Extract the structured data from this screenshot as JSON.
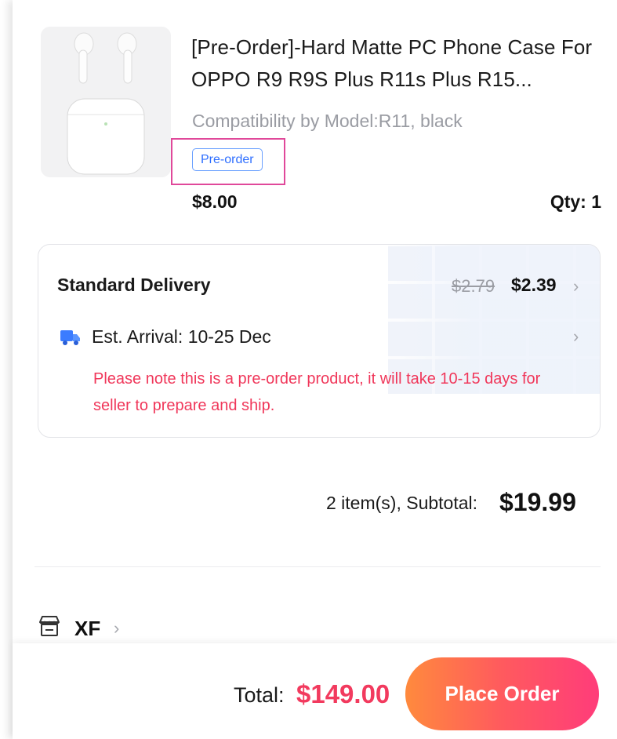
{
  "product": {
    "title": "[Pre-Order]-Hard Matte PC Phone Case For OPPO R9 R9S Plus R11s Plus R15...",
    "variant": "Compatibility by Model:R11, black",
    "badge": "Pre-order",
    "price": "$8.00",
    "qty": "Qty: 1",
    "image_icon": "earbuds-product-image"
  },
  "delivery": {
    "method": "Standard Delivery",
    "old_price": "$2.79",
    "new_price": "$2.39",
    "arrival": "Est. Arrival: 10-25 Dec",
    "note": "Please note this is a pre-order product, it will take 10-15 days for seller to prepare and ship.",
    "truck_icon": "truck-icon"
  },
  "summary": {
    "subtotal_label": "2 item(s), Subtotal:",
    "subtotal_value": "$19.99"
  },
  "store": {
    "name": "XF",
    "icon": "store-icon"
  },
  "footer": {
    "total_label": "Total:",
    "total_value": "$149.00",
    "place_order_label": "Place Order"
  },
  "colors": {
    "accent_red": "#f23a5e",
    "badge_blue": "#2f6fff",
    "button_gradient_start": "#ff8a3d",
    "button_gradient_end": "#ff3c7a",
    "highlight_pink": "#e0489a"
  }
}
